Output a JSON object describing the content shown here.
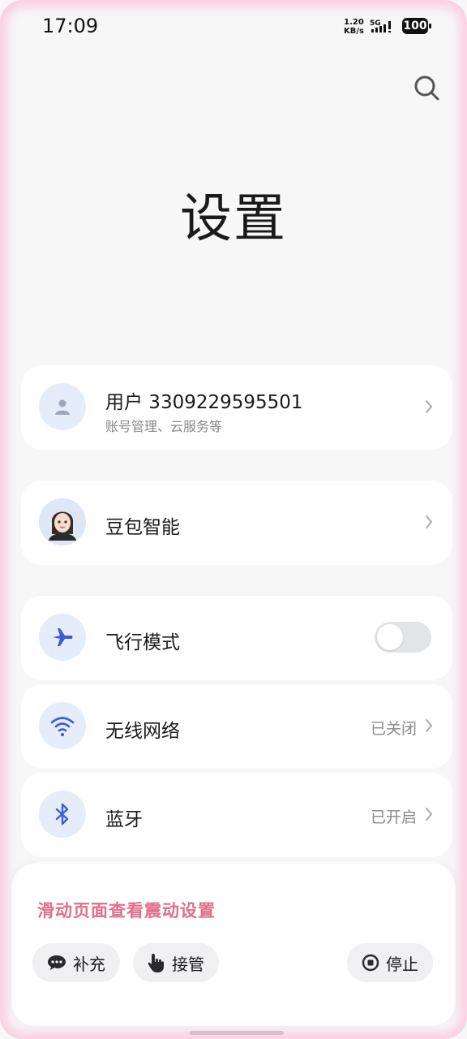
{
  "status_bar": {
    "time": "17:09",
    "net_speed_value": "1.20",
    "net_speed_unit": "KB/s",
    "network_type": "5G",
    "battery": "100"
  },
  "header": {
    "title": "设置",
    "search_icon": "search-icon"
  },
  "account": {
    "name": "用户 3309229595501",
    "subtitle": "账号管理、云服务等"
  },
  "assistant": {
    "label": "豆包智能"
  },
  "airplane": {
    "label": "飞行模式",
    "enabled": false
  },
  "wifi": {
    "label": "无线网络",
    "value": "已关闭"
  },
  "bluetooth": {
    "label": "蓝牙",
    "value": "已开启"
  },
  "overlay": {
    "hint": "滑动页面查看震动设置",
    "supplement_label": "补充",
    "takeover_label": "接管",
    "stop_label": "停止"
  },
  "colors": {
    "accent_icon": "#3f5bd6",
    "hint": "#e06f8b",
    "icon_bg": "#e4edf9"
  }
}
